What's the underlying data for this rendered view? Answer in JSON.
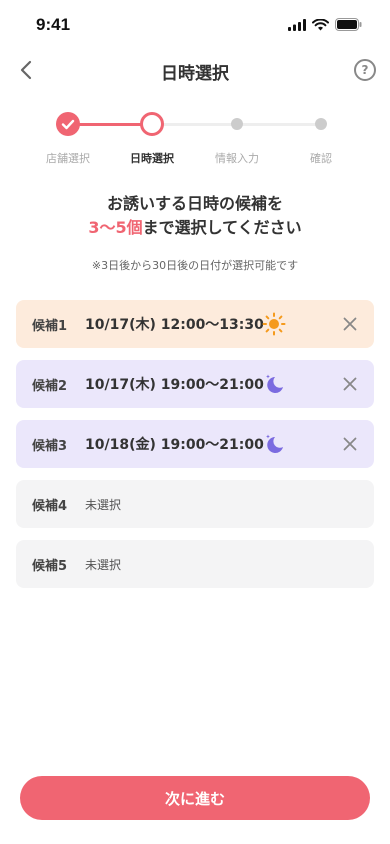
{
  "status_bar": {
    "time": "9:41"
  },
  "header": {
    "title": "日時選択"
  },
  "stepper": {
    "steps": [
      {
        "label": "店舗選択",
        "state": "done"
      },
      {
        "label": "日時選択",
        "state": "current"
      },
      {
        "label": "情報入力",
        "state": "pending"
      },
      {
        "label": "確認",
        "state": "pending"
      }
    ]
  },
  "headline": {
    "line1": "お誘いする日時の候補を",
    "highlight": "3〜5個",
    "line2_rest": "まで選択してください"
  },
  "note": "※3日後から30日後の日付が選択可能です",
  "candidates": [
    {
      "label": "候補1",
      "value": "10/17(木) 12:00〜13:30",
      "icon": "sun-icon",
      "selected": true
    },
    {
      "label": "候補2",
      "value": "10/17(木) 19:00〜21:00",
      "icon": "moon-icon",
      "selected": true
    },
    {
      "label": "候補3",
      "value": "10/18(金) 19:00〜21:00",
      "icon": "moon-icon",
      "selected": true
    },
    {
      "label": "候補4",
      "value": "未選択",
      "selected": false
    },
    {
      "label": "候補5",
      "value": "未選択",
      "selected": false
    }
  ],
  "next_button": {
    "label": "次に進む"
  },
  "colors": {
    "accent": "#f06572",
    "day_bg": "#fdebdc",
    "night_bg": "#ebe7fb",
    "empty_bg": "#f4f4f5",
    "sun": "#f59a1c",
    "moon": "#7b6be0"
  }
}
